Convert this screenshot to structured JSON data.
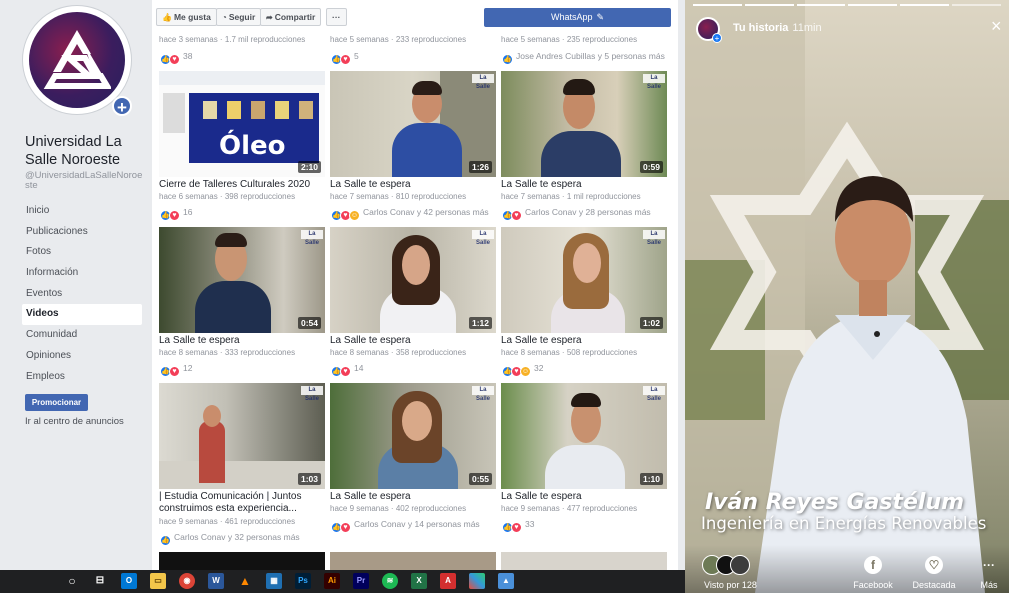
{
  "sidebar": {
    "page_name": "Universidad La Salle Noroeste",
    "page_handle": "@UniversidadLaSalleNoroeste",
    "nav": [
      "Inicio",
      "Publicaciones",
      "Fotos",
      "Información",
      "Eventos",
      "Videos",
      "Comunidad",
      "Opiniones",
      "Empleos"
    ],
    "active_nav": "Videos",
    "promote_label": "Promocionar",
    "ads_center_label": "Ir al centro de anuncios"
  },
  "actions": {
    "like_label": "Me gusta",
    "follow_label": "Seguir",
    "share_label": "Compartir",
    "more_label": "···",
    "whatsapp_label": "WhatsApp"
  },
  "top_row": [
    {
      "meta": "hace 3 semanas · 1.7 mil reproducciones",
      "reactions": "38"
    },
    {
      "meta": "hace 5 semanas · 233 reproducciones",
      "reactions": "5"
    },
    {
      "meta": "hace 5 semanas · 235 reproducciones",
      "reactions": "Jose Andres Cubillas y 5 personas más"
    }
  ],
  "videos": [
    {
      "title": "Cierre de Talleres Culturales 2020",
      "meta": "hace 6 semanas · 398 reproducciones",
      "reactions": "16",
      "duration": "2:10"
    },
    {
      "title": "La Salle te espera",
      "meta": "hace 7 semanas · 810 reproducciones",
      "reactions": "Carlos Conav y 42 personas más",
      "duration": "1:26"
    },
    {
      "title": "La Salle te espera",
      "meta": "hace 7 semanas · 1 mil reproducciones",
      "reactions": "Carlos Conav y 28 personas más",
      "duration": "0:59"
    },
    {
      "title": "La Salle te espera",
      "meta": "hace 8 semanas · 333 reproducciones",
      "reactions": "12",
      "duration": "0:54"
    },
    {
      "title": "La Salle te espera",
      "meta": "hace 8 semanas · 358 reproducciones",
      "reactions": "14",
      "duration": "1:12"
    },
    {
      "title": "La Salle te espera",
      "meta": "hace 8 semanas · 508 reproducciones",
      "reactions": "32",
      "duration": "1:02"
    },
    {
      "title": "| Estudia Comunicación | Juntos construimos esta experiencia...",
      "meta": "hace 9 semanas · 461 reproducciones",
      "reactions": "Carlos Conav y 32 personas más",
      "duration": "1:03"
    },
    {
      "title": "La Salle te espera",
      "meta": "hace 9 semanas · 402 reproducciones",
      "reactions": "Carlos Conav y 14 personas más",
      "duration": "0:55"
    },
    {
      "title": "La Salle te espera",
      "meta": "hace 9 semanas · 477 reproducciones",
      "reactions": "33",
      "duration": "1:10"
    }
  ],
  "thumb_text": {
    "oleo": "Óleo",
    "logo": "La Salle"
  },
  "story": {
    "title": "Tu historia",
    "time": "11min",
    "close": "×",
    "caption_name": "Iván Reyes Gastélum",
    "caption_sub": "Ingeniería en Energías Renovables",
    "viewed_by": "Visto por 128",
    "actions": [
      "Facebook",
      "Destacada",
      "Más"
    ]
  },
  "colors": {
    "brand": "#4267b2",
    "like": "#1877f2",
    "love": "#f33e58",
    "avatar": "#3b1d5e"
  }
}
